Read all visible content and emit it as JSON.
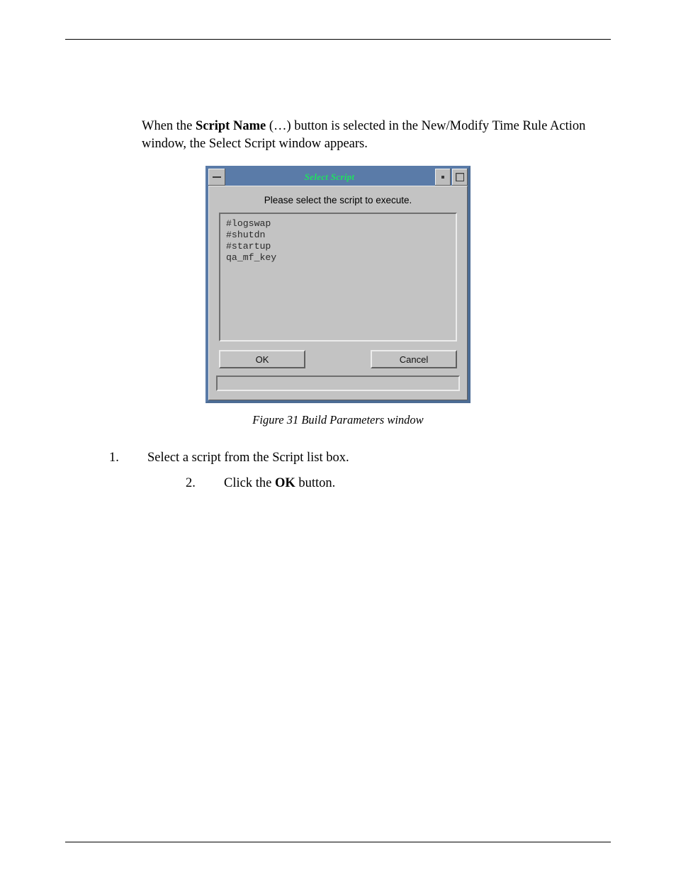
{
  "intro": {
    "prefix": "When the ",
    "bold1": "Script Name",
    "mid": " (…) button is selected in the New/Modify Time Rule Action window, the Select Script window appears."
  },
  "dialog": {
    "title": "Select Script",
    "prompt": "Please select the script to execute.",
    "items": [
      "#logswap",
      "#shutdn",
      "#startup",
      "qa_mf_key"
    ],
    "ok": "OK",
    "cancel": "Cancel"
  },
  "caption": "Figure 31 Build Parameters window",
  "steps": {
    "n1": "1.",
    "t1": "Select a script from the Script list box.",
    "n2": "2.",
    "t2_pre": "Click the ",
    "t2_bold": "OK",
    "t2_post": " button."
  }
}
